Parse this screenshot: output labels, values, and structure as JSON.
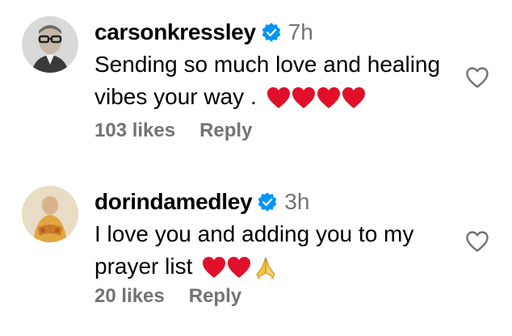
{
  "comments": [
    {
      "username": "carsonkressley",
      "time": "7h",
      "text": "Sending so much love and healing vibes your way .",
      "emoji_icons": [
        "red-heart-icon",
        "red-heart-icon",
        "red-heart-icon",
        "red-heart-icon"
      ],
      "likes": "103 likes",
      "reply_label": "Reply",
      "avatar_icon": "avatar-photo"
    },
    {
      "username": "dorindamedley",
      "time": "3h",
      "text": "I love you and adding you to my prayer list",
      "emoji_icons": [
        "red-heart-icon",
        "red-heart-icon",
        "folded-hands-icon"
      ],
      "likes": "20 likes",
      "reply_label": "Reply",
      "avatar_icon": "avatar-photo"
    }
  ],
  "colors": {
    "verified_badge": "#0095f6",
    "secondary_text": "#737373",
    "heart_emoji": "#e0102a",
    "text": "#000000"
  }
}
